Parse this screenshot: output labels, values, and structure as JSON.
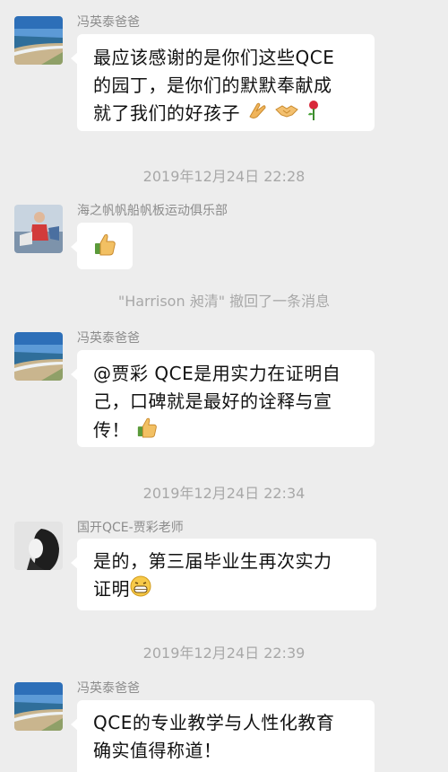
{
  "messages": [
    {
      "sender": "冯英泰爸爸",
      "lines": [
        "最应该感谢的是你们这些QCE",
        "的园丁，是你们的默默奉献成",
        "就了我们的好孩子"
      ],
      "emojis": [
        "clap-hands-icon",
        "handshake-icon",
        "rose-icon"
      ]
    },
    {
      "sender": "海之帆帆船帆板运动俱乐部",
      "lines": [],
      "emojis": [
        "thumbs-up-icon"
      ]
    },
    {
      "sender": "冯英泰爸爸",
      "lines": [
        "@贾彩 QCE是用实力在证明自",
        "己，口碑就是最好的诠释与宣",
        "传！"
      ],
      "emojis": [
        "thumbs-up-icon"
      ]
    },
    {
      "sender": "国开QCE-贾彩老师",
      "lines": [
        "是的，第三届毕业生再次实力",
        "证明"
      ],
      "emojis": [
        "grin-icon"
      ]
    },
    {
      "sender": "冯英泰爸爸",
      "lines": [
        "QCE的专业教学与人性化教育",
        "确实值得称道！"
      ],
      "emojis": []
    }
  ],
  "timestamps": [
    "2019年12月24日 22:28",
    "2019年12月24日 22:34",
    "2019年12月24日 22:39"
  ],
  "system_notice": "\"Harrison 昶清\" 撤回了一条消息",
  "colors": {
    "background": "#ededed",
    "bubble": "#ffffff",
    "meta_text": "#a8a8a8"
  }
}
